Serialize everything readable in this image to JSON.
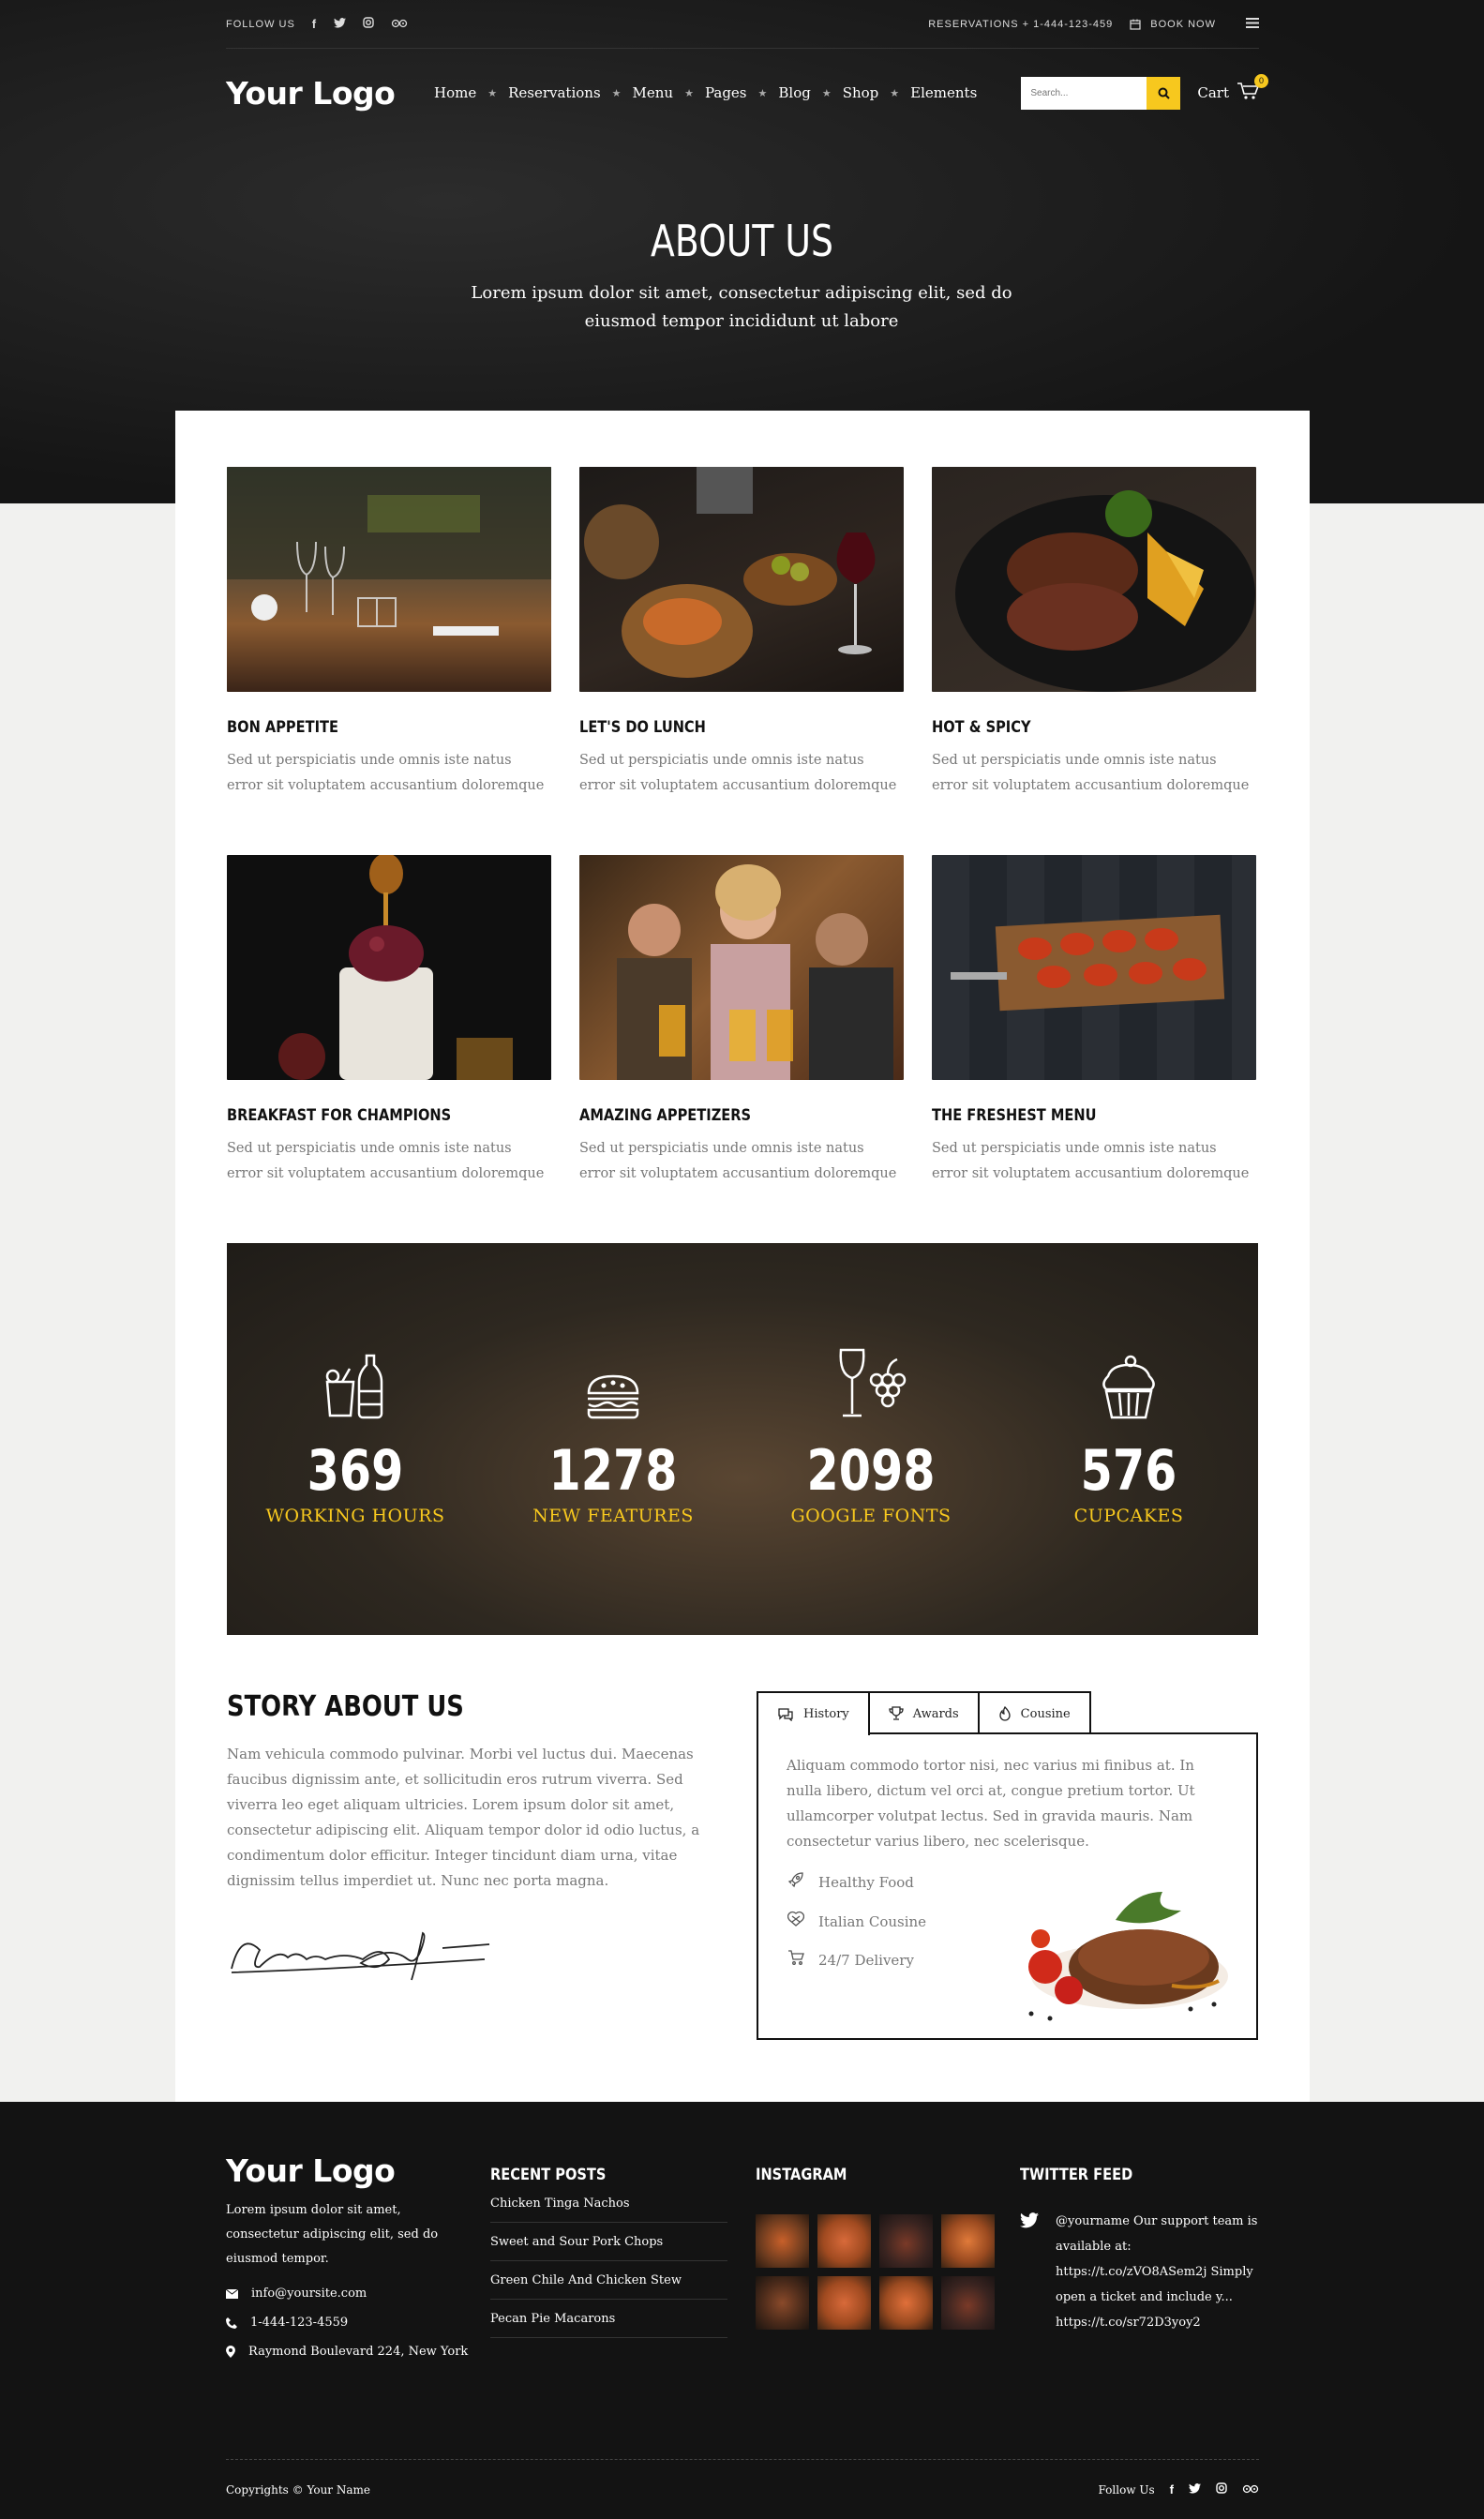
{
  "topbar": {
    "follow_label": "FOLLOW US",
    "social_icons": [
      "facebook-icon",
      "twitter-icon",
      "instagram-icon",
      "tripadvisor-icon"
    ],
    "reservations": "RESERVATIONS + 1-444-123-459",
    "book_now": "BOOK NOW"
  },
  "nav": {
    "logo": "Your Logo",
    "items": [
      "Home",
      "Reservations",
      "Menu",
      "Pages",
      "Blog",
      "Shop",
      "Elements"
    ],
    "search_placeholder": "Search...",
    "cart_label": "Cart",
    "cart_count": "0"
  },
  "hero": {
    "title": "ABOUT US",
    "subtitle": "Lorem ipsum dolor sit amet, consectetur adipiscing elit, sed do eiusmod tempor incididunt ut labore"
  },
  "cards": [
    {
      "title": "BON APPETITE",
      "text": "Sed ut perspiciatis unde omnis iste natus error sit voluptatem accusantium doloremque"
    },
    {
      "title": "LET'S DO LUNCH",
      "text": "Sed ut perspiciatis unde omnis iste natus error sit voluptatem accusantium doloremque"
    },
    {
      "title": "HOT & SPICY",
      "text": "Sed ut perspiciatis unde omnis iste natus error sit voluptatem accusantium doloremque"
    },
    {
      "title": "BREAKFAST FOR CHAMPIONS",
      "text": "Sed ut perspiciatis unde omnis iste natus error sit voluptatem accusantium doloremque"
    },
    {
      "title": "AMAZING APPETIZERS",
      "text": "Sed ut perspiciatis unde omnis iste natus error sit voluptatem accusantium doloremque"
    },
    {
      "title": "THE FRESHEST MENU",
      "text": "Sed ut perspiciatis unde omnis iste natus error sit voluptatem accusantium doloremque"
    }
  ],
  "counters": [
    {
      "icon": "drinks-icon",
      "number": "369",
      "label": "WORKING HOURS"
    },
    {
      "icon": "burger-icon",
      "number": "1278",
      "label": "NEW FEATURES"
    },
    {
      "icon": "wine-grapes-icon",
      "number": "2098",
      "label": "GOOGLE FONTS"
    },
    {
      "icon": "cupcake-icon",
      "number": "576",
      "label": "CUPCAKES"
    }
  ],
  "story": {
    "title": "STORY ABOUT US",
    "text": "Nam vehicula commodo pulvinar. Morbi vel luctus dui. Maecenas faucibus dignissim ante, et sollicitudin eros rutrum viverra. Sed viverra leo eget aliquam ultricies. Lorem ipsum dolor sit amet, consectetur adipiscing elit. Aliquam tempor dolor id odio luctus, a condimentum dolor efficitur. Integer tincidunt diam urna, vitae dignissim tellus imperdiet ut. Nunc nec porta magna."
  },
  "tabs": {
    "items": [
      {
        "label": "History",
        "icon": "chat-icon"
      },
      {
        "label": "Awards",
        "icon": "trophy-icon"
      },
      {
        "label": "Cousine",
        "icon": "flame-icon"
      }
    ],
    "active": "History",
    "text": "Aliquam commodo tortor nisi, nec varius mi finibus at. In nulla libero, dictum vel orci at, congue pretium tortor. Ut ullamcorper volutpat lectus. Sed in gravida mauris. Nam consectetur varius libero, nec scelerisque.",
    "features": [
      {
        "icon": "rocket-icon",
        "label": "Healthy Food"
      },
      {
        "icon": "pretzel-icon",
        "label": "Italian Cousine"
      },
      {
        "icon": "cart-icon",
        "label": "24/7 Delivery"
      }
    ]
  },
  "footer": {
    "logo": "Your Logo",
    "about": "Lorem ipsum dolor sit amet, consectetur adipiscing elit, sed do eiusmod tempor.",
    "email": "info@yoursite.com",
    "phone": "1-444-123-4559",
    "address": "Raymond Boulevard 224, New York",
    "recent_posts_title": "RECENT POSTS",
    "posts": [
      "Chicken Tinga Nachos",
      "Sweet and Sour Pork Chops",
      "Green Chile And Chicken Stew",
      "Pecan Pie Macarons"
    ],
    "instagram_title": "INSTAGRAM",
    "twitter_title": "TWITTER FEED",
    "tweet": "@yourname  Our support team is available at: https://t.co/zVO8ASem2j Simply open a ticket and include y... https://t.co/sr72D3yoy2",
    "copyright": "Copyrights © Your Name",
    "follow_label": "Follow Us"
  },
  "colors": {
    "accent": "#f7c81e",
    "dark": "#131313"
  }
}
